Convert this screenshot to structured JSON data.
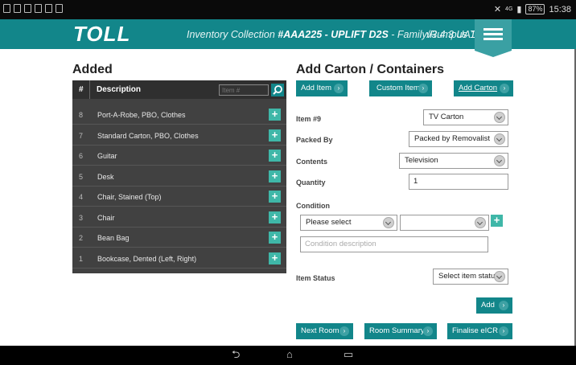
{
  "statusbar": {
    "time": "15:38",
    "battery": "87%",
    "signal": "4G"
  },
  "header": {
    "logo": "TOLL",
    "title_prefix": "Inventory Collection ",
    "job": "#AAA225 - UPLIFT D2S",
    "title_suffix": " - Family/Rumpus 1",
    "version": "v3.4.3 UAT"
  },
  "added": {
    "title": "Added",
    "col_number": "#",
    "col_description": "Description",
    "search_placeholder": "Item #",
    "rows": [
      {
        "n": "8",
        "desc": "Port-A-Robe, PBO, Clothes"
      },
      {
        "n": "7",
        "desc": "Standard Carton, PBO, Clothes"
      },
      {
        "n": "6",
        "desc": "Guitar"
      },
      {
        "n": "5",
        "desc": "Desk"
      },
      {
        "n": "4",
        "desc": "Chair, Stained (Top)"
      },
      {
        "n": "3",
        "desc": "Chair"
      },
      {
        "n": "2",
        "desc": "Bean Bag"
      },
      {
        "n": "1",
        "desc": "Bookcase, Dented (Left, Right)"
      }
    ]
  },
  "form": {
    "title": "Add Carton / Containers",
    "tabs": {
      "add_item": "Add Item",
      "custom_item": "Custom Item",
      "add_carton": "Add Carton"
    },
    "item_label": "Item #9",
    "item_value": "TV Carton",
    "packed_label": "Packed By",
    "packed_value": "Packed by Removalist",
    "contents_label": "Contents",
    "contents_value": "Television",
    "quantity_label": "Quantity",
    "quantity_value": "1",
    "condition_label": "Condition",
    "condition_select": "Please select",
    "condition_select2": "",
    "condition_placeholder": "Condition description",
    "status_label": "Item Status",
    "status_value": "Select item status",
    "add_button": "Add",
    "next_room": "Next Room",
    "room_summary": "Room Summary",
    "finalise": "Finalise eICR"
  },
  "colors": {
    "teal": "#12868a",
    "accent": "#3fb7a8",
    "dark": "#414141"
  },
  "icons": {
    "search": "search-icon",
    "plus": "plus-icon",
    "chevron": "chevron-down-icon",
    "arrow": "chevron-right-icon",
    "menu": "hamburger-icon",
    "back": "back-icon",
    "home": "home-icon",
    "recents": "recents-icon"
  }
}
